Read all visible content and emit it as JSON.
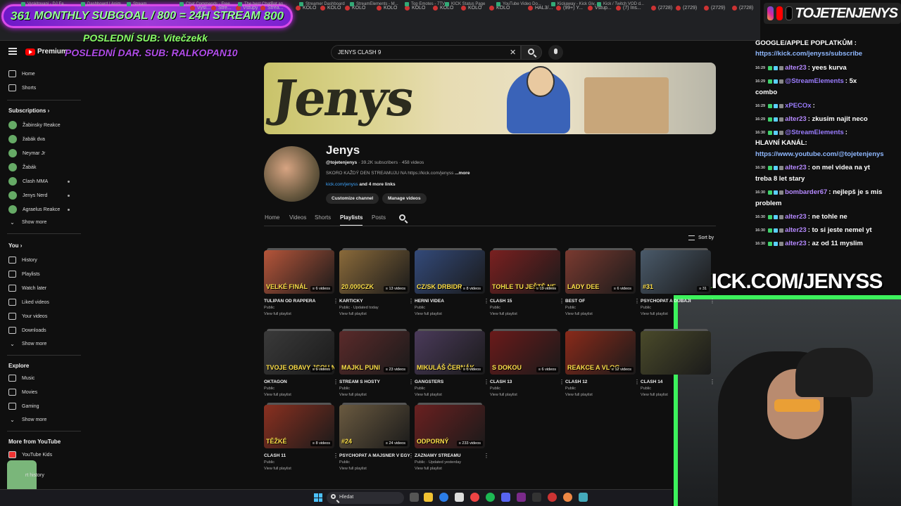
{
  "overlay": {
    "subgoal_left": "361",
    "subgoal_mid": "MONTHLY SUBGOAL / 800 = 24H STREAM",
    "subgoal_right": "800",
    "last_sub": "POSLEDNÍ SUB: Vitečzekk",
    "last_donation": "POSLEDNÍ DAR. SUB: RALKOPAN10",
    "social_handle": "TOJETENJENYS",
    "kick_prefix": "K",
    "kick_url": "ICK.COM/JENYSS"
  },
  "browser": {
    "tabs": [
      "Vysl...",
      "Stre...",
      "Vstupy",
      "Strea...",
      "KOLO",
      "KOLO",
      "KOLO",
      "KOLO",
      "KOLO",
      "KOLO",
      "KOLO",
      "KOLO",
      "HAL3/...",
      "(99+) Y...",
      "Vstup...",
      "(7) Ins...",
      "(2728)",
      "(2729)",
      "(2729)",
      "(2728)"
    ],
    "bookmarks": [
      "Vyskitovani - DJ Fa...",
      "Dashboard | Anim...",
      "Stream...",
      "Chat Commands - Free...",
      "The best ChatBot an...",
      "Streamer Dashboard",
      "StreamElements - M...",
      "Top Emotes - 7TV",
      "KICK Status Page",
      "YouTube Video Do...",
      "Kickaway - Kick Giv...",
      "Kick / Twitch VOD d..."
    ]
  },
  "youtube": {
    "logo": "Premium",
    "search_value": "JENYS CLASH 9",
    "sidebar": {
      "main": [
        {
          "label": "Home",
          "icon": "home-icon"
        },
        {
          "label": "Shorts",
          "icon": "shorts-icon"
        }
      ],
      "subscriptions_title": "Subscriptions",
      "subscriptions": [
        "Žabinsky Reakce",
        "žabák dva",
        "Neymar Jr",
        "Žabák",
        "Clash MMA",
        "Jenys Nerd",
        "Agraelus Reakce"
      ],
      "show_more": "Show more",
      "you_title": "You",
      "you": [
        {
          "label": "History",
          "icon": "history-icon"
        },
        {
          "label": "Playlists",
          "icon": "playlist-icon"
        },
        {
          "label": "Watch later",
          "icon": "clock-icon"
        },
        {
          "label": "Liked videos",
          "icon": "like-icon"
        },
        {
          "label": "Your videos",
          "icon": "video-icon"
        },
        {
          "label": "Downloads",
          "icon": "download-icon"
        }
      ],
      "explore_title": "Explore",
      "explore": [
        {
          "label": "Music",
          "icon": "music-icon"
        },
        {
          "label": "Movies",
          "icon": "movie-icon"
        },
        {
          "label": "Gaming",
          "icon": "gaming-icon"
        }
      ],
      "more_title": "More from YouTube",
      "more": [
        "YouTube Kids"
      ],
      "history_partial": "rt history"
    },
    "channel": {
      "name": "Jenys",
      "handle": "@tojetenjenys",
      "meta": "· 39.2K subscribers · 458 videos",
      "desc": "SKORO KAŽDÝ DEN STREAMUJU NA https://kick.com/jenyss",
      "desc_more": "...more",
      "link": "kick.com/jenyss",
      "link_more": "and 4 more links",
      "btn_customize": "Customize channel",
      "btn_manage": "Manage videos",
      "banner_text": "Jenys"
    },
    "tabs": [
      "Home",
      "Videos",
      "Shorts",
      "Playlists",
      "Posts"
    ],
    "active_tab": "Playlists",
    "sort": "Sort by",
    "playlists": [
      {
        "title": "TULIPÁN OD RAPPERA",
        "status": "Public",
        "count": "6 videos",
        "thumb_text": "VELKÉ FINÁL",
        "color": "#b5553a"
      },
      {
        "title": "KARTIČKY",
        "status": "Public · Updated today",
        "count": "13 videos",
        "thumb_text": "20.000CZK",
        "color": "#8a6a3a"
      },
      {
        "title": "HERNÍ VIDEA",
        "status": "Public",
        "count": "8 videos",
        "thumb_text": "CZ/SK DRBIDR",
        "color": "#334a7a"
      },
      {
        "title": "CLASH 15",
        "status": "Public",
        "count": "13 videos",
        "thumb_text": "TOHLE TU JEŠTĚ NE",
        "color": "#7a2020"
      },
      {
        "title": "BEST OF",
        "status": "Public",
        "count": "6 videos",
        "thumb_text": "LADY DEE",
        "color": "#7a3a30"
      },
      {
        "title": "PSYCHOPAT A DUBAJI",
        "status": "Public",
        "count": "31",
        "thumb_text": "#31",
        "color": "#4a5a6a"
      },
      {
        "title": "OKTAGON",
        "status": "Public",
        "count": "6 videos",
        "thumb_text": "TVOJE OBAVY JSOU NA MÍSTĚ",
        "color": "#3a3a3a"
      },
      {
        "title": "STREAM S HOSTY",
        "status": "Public",
        "count": "23 videos",
        "thumb_text": "MAJKL PUNI",
        "color": "#5a2a2a"
      },
      {
        "title": "GANGSTERS",
        "status": "Public",
        "count": "6 videos",
        "thumb_text": "MIKULÁŠ ČERNÁK",
        "color": "#4a3a5a"
      },
      {
        "title": "CLASH 13",
        "status": "Public",
        "count": "6 videos",
        "thumb_text": "S DOKOU",
        "color": "#6a1a1a"
      },
      {
        "title": "CLASH 12",
        "status": "Public",
        "count": "12 videos",
        "thumb_text": "REAKCE A VLOG",
        "color": "#8a2a1a"
      },
      {
        "title": "CLASH 14",
        "status": "Public",
        "count": "",
        "thumb_text": "",
        "color": "#4a4a2a"
      },
      {
        "title": "CLASH 11",
        "status": "Public",
        "count": "8 videos",
        "thumb_text": "TĚŽKÉ",
        "color": "#8a3020"
      },
      {
        "title": "PSYCHOPAT A MAJSNER V EGYPTĚ - 2017",
        "status": "Public",
        "count": "24 videos",
        "thumb_text": "#24",
        "color": "#6a5a40"
      },
      {
        "title": "ZÁZNAMY STREAMU",
        "status": "Public · Updated yesterday",
        "count": "233 videos",
        "thumb_text": "ODPORNÝ",
        "color": "#6a2020"
      }
    ],
    "view_full": "View full playlist"
  },
  "chat": [
    {
      "text": "GOOGLE/APPLE POPLATKŮM :",
      "type": "plain"
    },
    {
      "text": "https://kick.com/jenyss/subscribe",
      "type": "link"
    },
    {
      "time": "16:29",
      "user": "alter23",
      "msg": " : yees kurva"
    },
    {
      "time": "16:29",
      "user": "@StreamElements",
      "msg": " : 5x"
    },
    {
      "text": "combo",
      "type": "plain"
    },
    {
      "time": "16:29",
      "user": "xPECOx",
      "msg": " :"
    },
    {
      "time": "16:29",
      "user": "alter23",
      "msg": " : zkusim najit neco"
    },
    {
      "time": "16:30",
      "user": "@StreamElements",
      "msg": " :"
    },
    {
      "text": "HLAVNÍ KANÁL:",
      "type": "plain"
    },
    {
      "text": "https://www.youtube.com/@tojetenjenys",
      "type": "link"
    },
    {
      "time": "16:30",
      "user": "alter23",
      "msg": " : on mel videa na yt"
    },
    {
      "text": "treba 8 let stary",
      "type": "plain"
    },
    {
      "time": "16:30",
      "user": "bombarder67",
      "msg": " : nejlepš je s mis"
    },
    {
      "text": "problem",
      "type": "plain"
    },
    {
      "time": "16:30",
      "user": "alter23",
      "msg": " : ne tohle ne"
    },
    {
      "time": "16:30",
      "user": "alter23",
      "msg": " : to si jeste nemel yt"
    },
    {
      "time": "16:30",
      "user": "alter23",
      "msg": " : az od 11 myslim"
    }
  ],
  "taskbar": {
    "search": "Hledat"
  }
}
